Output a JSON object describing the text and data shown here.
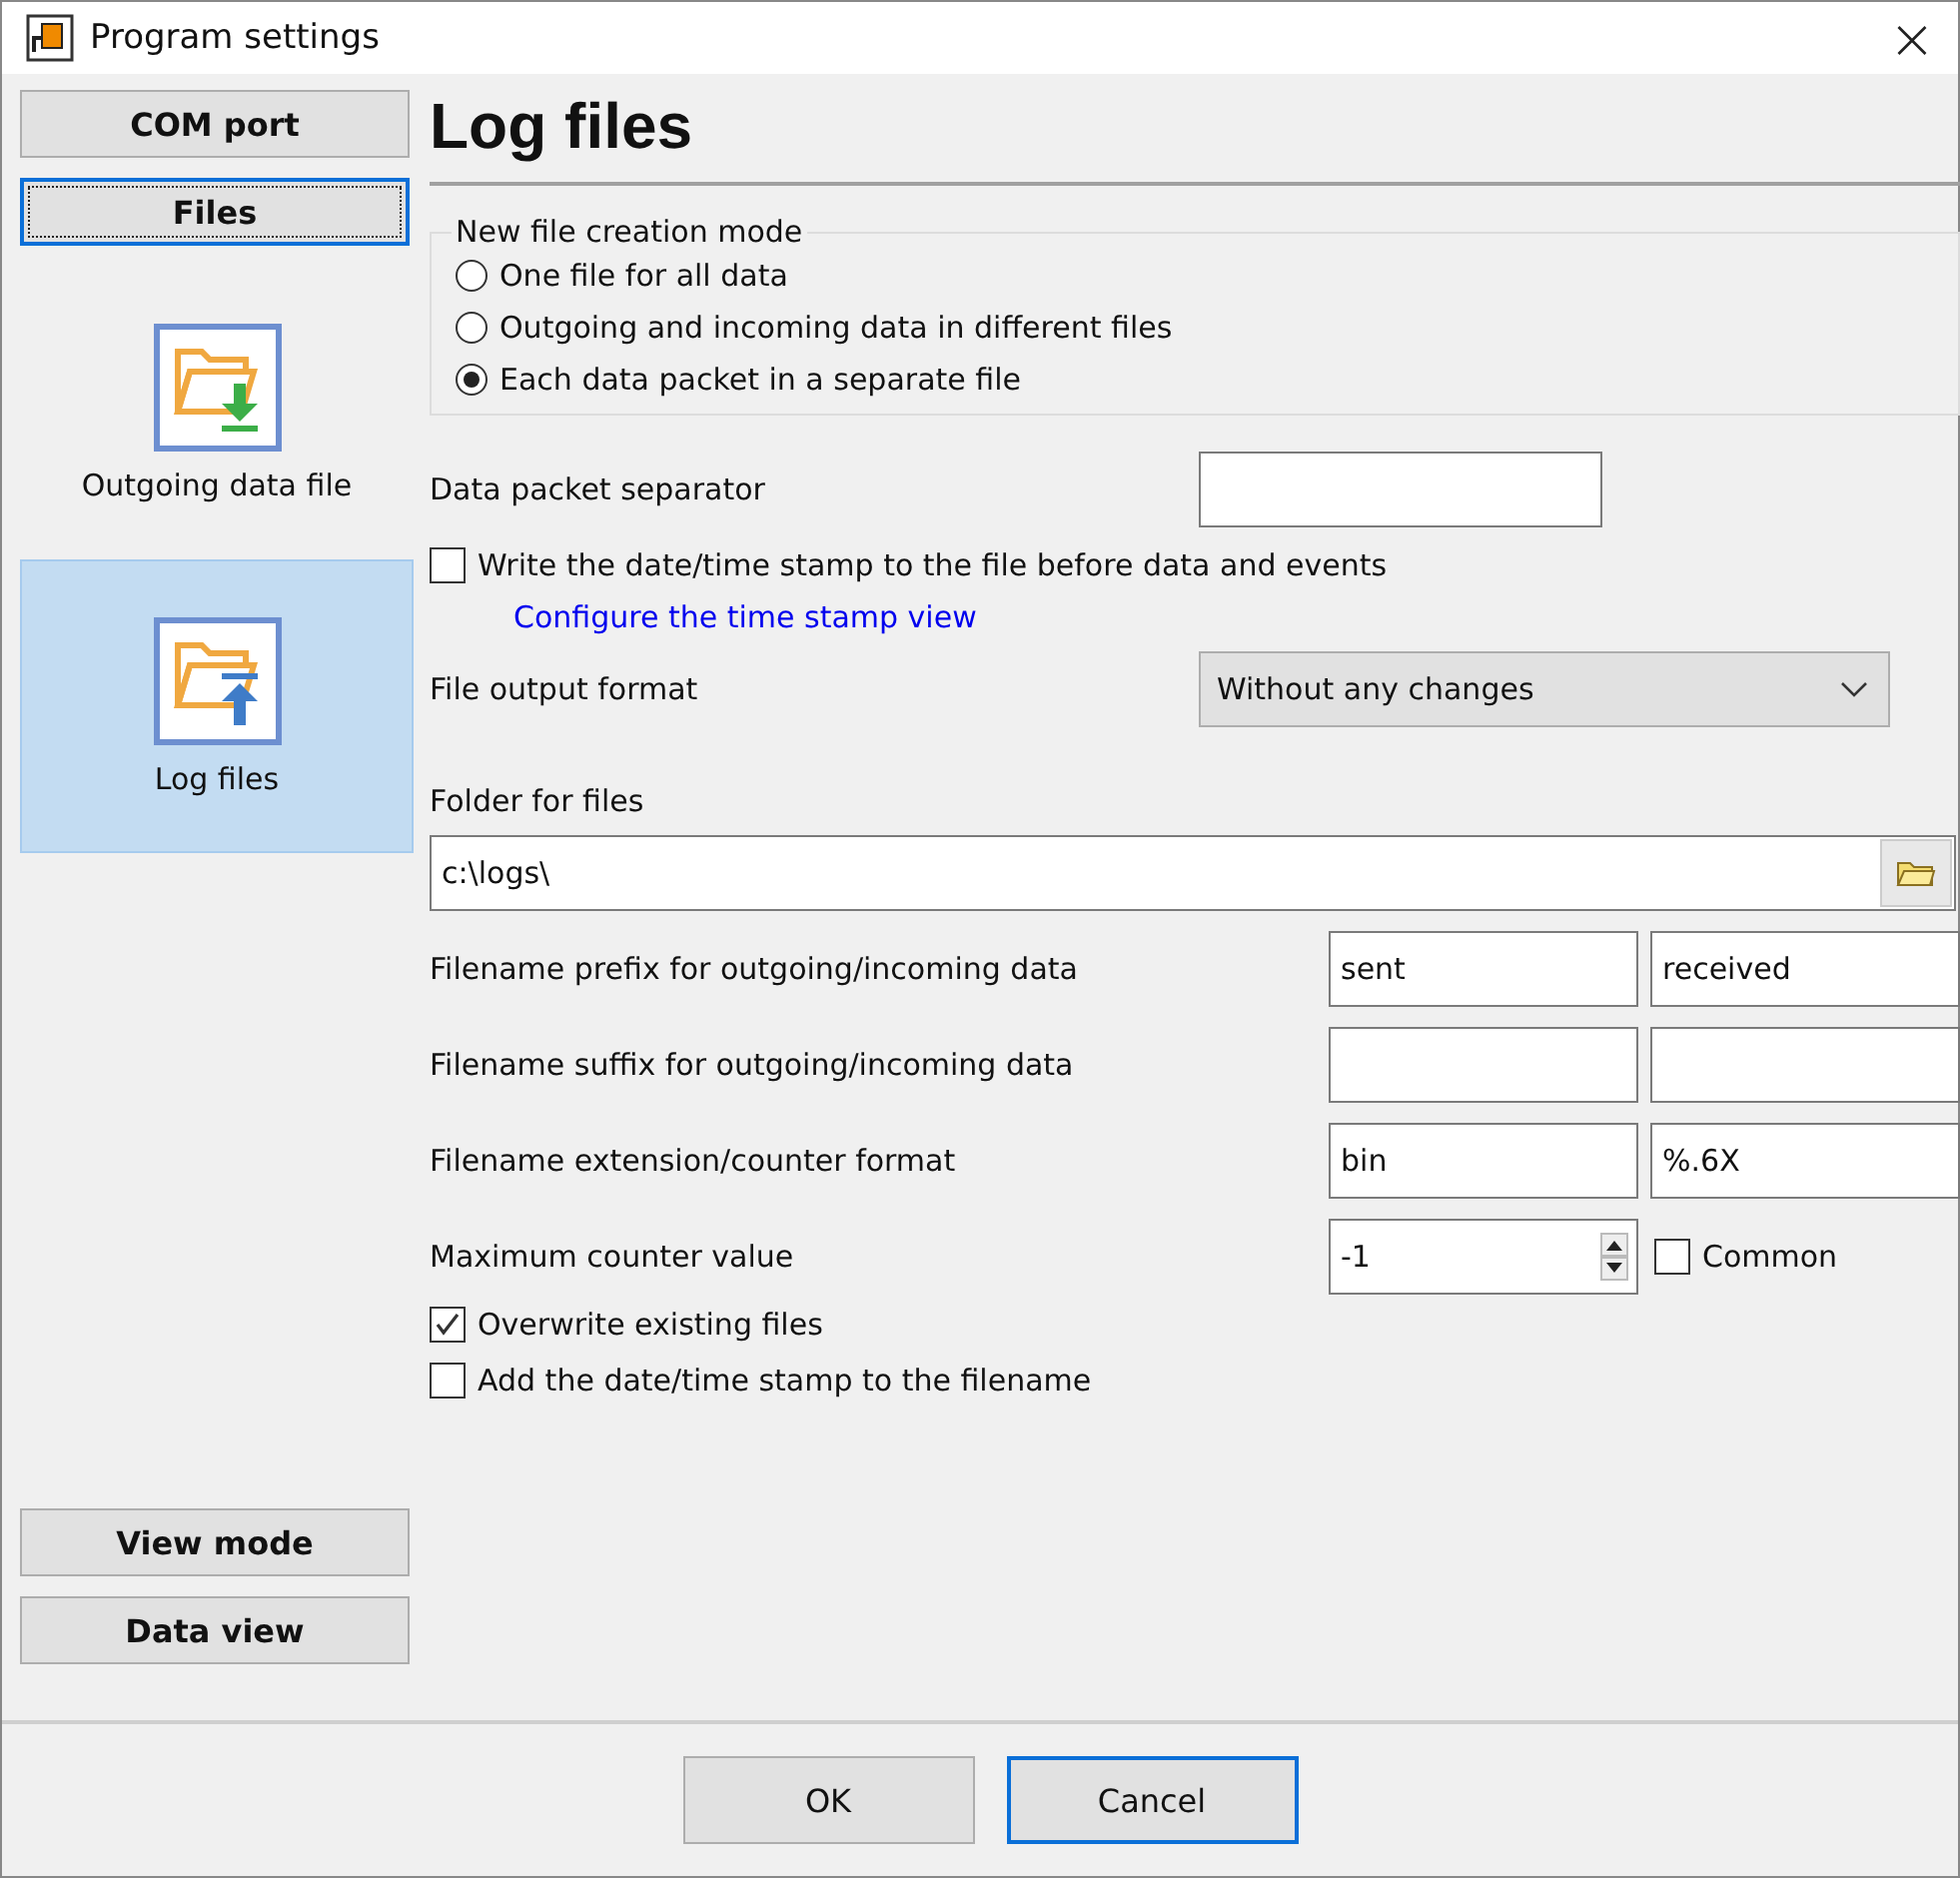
{
  "window": {
    "title": "Program settings",
    "close": "×"
  },
  "sidebar": {
    "top_buttons": [
      {
        "label": "COM port",
        "focused": false
      },
      {
        "label": "Files",
        "focused": true
      }
    ],
    "items": [
      {
        "label": "Outgoing data file",
        "kind": "download",
        "selected": false
      },
      {
        "label": "Log files",
        "kind": "upload",
        "selected": true
      }
    ],
    "bottom_buttons": [
      {
        "label": "View mode",
        "focused": false
      },
      {
        "label": "Data view",
        "focused": false
      }
    ]
  },
  "heading": "Log files",
  "creation_mode": {
    "legend": "New file creation mode",
    "options": [
      {
        "label": "One file for all data",
        "selected": false
      },
      {
        "label": "Outgoing and incoming data in different files",
        "selected": false
      },
      {
        "label": "Each data packet in a separate file",
        "selected": true
      }
    ]
  },
  "separator": {
    "label": "Data packet separator"
  },
  "timestamp": {
    "label": "Write the date/time stamp to the file before data and events",
    "checked": false
  },
  "link": "Configure the time stamp view",
  "output_format": {
    "label": "File output format",
    "value": "Without any changes"
  },
  "folder": {
    "label": "Folder for files",
    "value": "c:\\logs\\"
  },
  "name_rows": [
    {
      "label": "Filename prefix for outgoing/incoming data",
      "first": "sent",
      "second": "received"
    },
    {
      "label": "Filename suffix for outgoing/incoming data"
    },
    {
      "label": "Filename extension/counter format",
      "first": "bin",
      "second": "%.6X"
    }
  ],
  "counter": {
    "label": "Maximum counter value",
    "value": "-1",
    "common": {
      "label": "Common",
      "checked": false
    }
  },
  "options": [
    {
      "label": "Overwrite existing files",
      "checked": true
    },
    {
      "label": "Add the date/time stamp to the filename",
      "checked": false
    }
  ],
  "buttons": [
    {
      "label": "OK",
      "focused": false
    },
    {
      "label": "Cancel",
      "focused": true
    }
  ]
}
